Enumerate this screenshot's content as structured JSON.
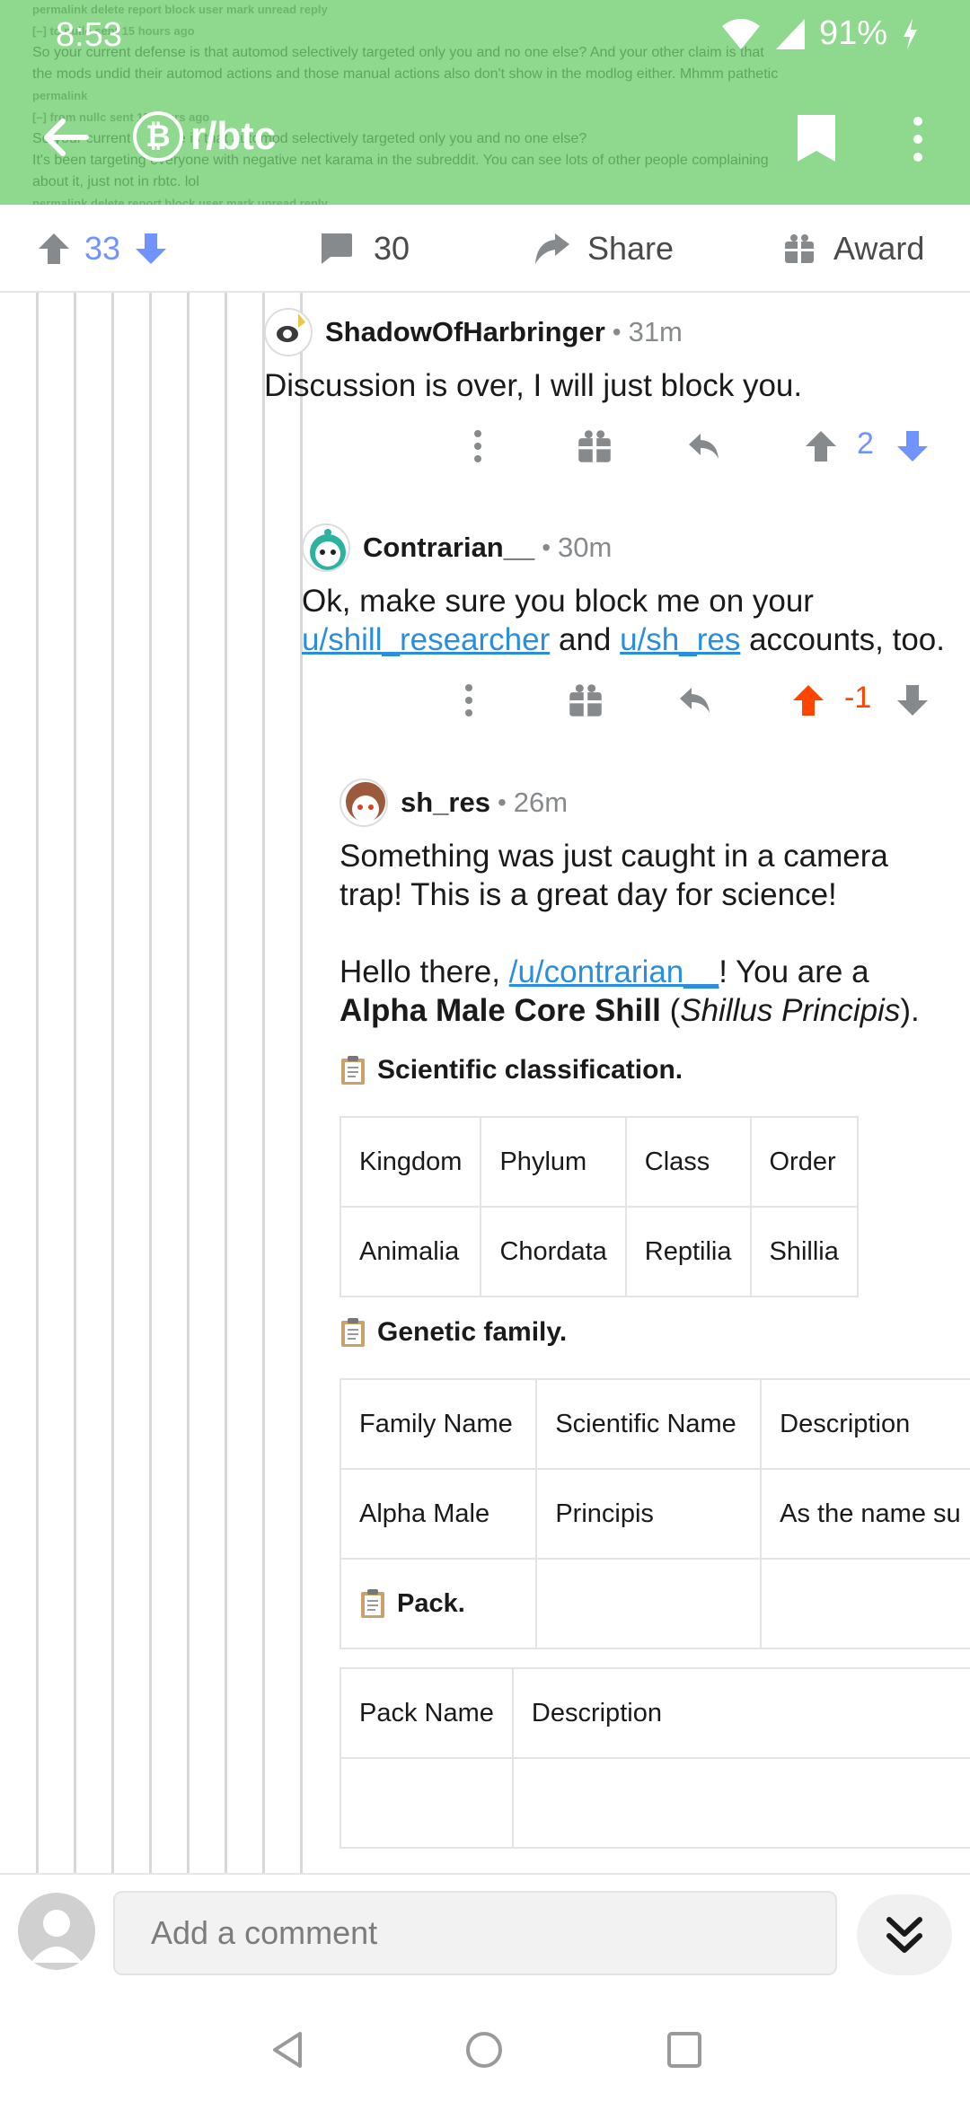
{
  "status_bar": {
    "time": "8:53",
    "battery": "91%"
  },
  "header": {
    "subreddit": "r/btc",
    "background_text": {
      "line1": "permalink  delete  report  block user  mark unread  reply",
      "line2_meta": "[–] to nullc sent 15 hours ago",
      "line3": "So your current defense is that automod selectively targeted only you and no one else? And your other claim is that",
      "line4": "the mods undid their automod actions and those manual actions also don't show in the modlog either. Mhmm pathetic",
      "line5": "permalink",
      "line6_meta": "[–] from nullc  sent 15 hours ago",
      "line7": "So your current defense is that automod selectively targeted only you and no one else?",
      "line8": "It's been targeting everyone with negative net karama in the subreddit. You can see lots of other people complaining",
      "line9": "about it, just not in rbtc. lol",
      "line10": "permalink  delete  report  block user  mark unread  reply"
    }
  },
  "action_bar": {
    "vote_count": "33",
    "comments_count": "30",
    "share_label": "Share",
    "award_label": "Award"
  },
  "comments": [
    {
      "author": "ShadowOfHarbringer",
      "age": "31m",
      "body": "Discussion is over, I will just block you.",
      "score": "2"
    },
    {
      "author": "Contrarian__",
      "age": "30m",
      "body_prefix": "Ok, make sure you block me on your ",
      "link1": "u/shill_researcher",
      "body_mid": " and ",
      "link2": "u/sh_res",
      "body_suffix": " accounts, too.",
      "score": "-1"
    },
    {
      "author": "sh_res",
      "age": "26m",
      "para1": "Something was just caught in a camera trap! This is a great day for science!",
      "para2_prefix": "Hello there, ",
      "para2_link": "/u/contrarian__",
      "para2_suffix": "! You are a",
      "species_common": "Alpha Male Core Shill",
      "species_latin": "Shillus Principis",
      "section1": "Scientific classification.",
      "classification": {
        "headers": [
          "Kingdom",
          "Phylum",
          "Class",
          "Order"
        ],
        "values": [
          "Animalia",
          "Chordata",
          "Reptilia",
          "Shillia"
        ]
      },
      "section2": "Genetic family.",
      "family": {
        "headers": [
          "Family Name",
          "Scientific Name",
          "Description"
        ],
        "row": [
          "Alpha Male",
          "Principis",
          "As the name su"
        ]
      },
      "section3": "Pack.",
      "pack": {
        "headers": [
          "Pack Name",
          "Description"
        ]
      }
    }
  ],
  "bottom": {
    "placeholder": "Add a comment"
  },
  "colors": {
    "header_bg": "#8fd98f",
    "upvote": "#ff4500",
    "downvote": "#7193ff",
    "link": "#2a8ee0"
  }
}
